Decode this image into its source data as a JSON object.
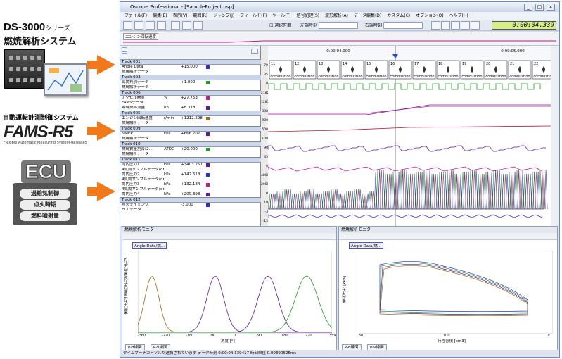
{
  "left": {
    "ds_title": "DS-3000",
    "ds_title_suffix": "シリーズ",
    "ds_subtitle": "燃焼解析システム",
    "fams_caption": "自動運転計測制御システム",
    "fams_logo": "FAMS-R5",
    "fams_sub": "Flexible Automatic Measuring System-Release5",
    "ecu_title": "ECU",
    "ecu_items": [
      "過給気制御",
      "点火時期",
      "燃料噴射量"
    ]
  },
  "window": {
    "title": "Oscope Professional - [SampleProject.osp]",
    "menu": [
      "ファイル(F)",
      "編集(E)",
      "表示(V)",
      "範囲(R)",
      "ジャンプ(J)",
      "フィールド(F)",
      "ツール(T)",
      "信号処理(S)",
      "波形解析(A)",
      "データ編集(D)",
      "カスタム(C)",
      "オプション(O)",
      "ヘルプ(H)"
    ],
    "toolbar": {
      "sync_label": "選択区間",
      "left_label": "左端時刻",
      "right_label": "右端時刻",
      "time_value": "0:00:04.339"
    },
    "overview_label": "エンジン回転速度",
    "timeline": {
      "t1": "0:00:04.000",
      "t2": "0:00:05.000"
    },
    "event_numbers": [
      "11",
      "12",
      "13",
      "14",
      "15",
      "16",
      "17",
      "18",
      "19",
      "20",
      "21",
      "22"
    ],
    "event_label": "combustion",
    "tracks": [
      {
        "header": "Track 001",
        "rows": [
          {
            "name": "Angle Data",
            "unit": "",
            "value": "+15.000"
          },
          {
            "name": "燃焼解析データ",
            "unit": "",
            "value": ""
          }
        ]
      },
      {
        "header": "Track 003",
        "rows": [
          {
            "name": "気筒判別データ",
            "unit": "",
            "value": "+1.000"
          },
          {
            "name": "燃焼解析データ",
            "unit": "",
            "value": ""
          }
        ]
      },
      {
        "header": "Track 006",
        "rows": [
          {
            "name": "アクセル開度",
            "unit": "%",
            "value": "+27.753"
          },
          {
            "name": "FAMSデータ",
            "unit": "",
            "value": ""
          },
          {
            "name": "瞬時燃料流量",
            "unit": "l/h",
            "value": "+8.378"
          }
        ]
      },
      {
        "header": "Track 005",
        "rows": [
          {
            "name": "エンジン回転速度",
            "unit": "r/min",
            "value": "+1212.298"
          },
          {
            "name": "燃焼解析データ",
            "unit": "",
            "value": ""
          }
        ]
      },
      {
        "header": "Track 009",
        "rows": [
          {
            "name": "NMEP",
            "unit": "kPa",
            "value": "+666.707"
          },
          {
            "name": "燃焼解析データ",
            "unit": "",
            "value": ""
          }
        ]
      },
      {
        "header": "Track 010",
        "rows": [
          {
            "name": "燃焼質量割合(2...",
            "unit": "ATDC",
            "value": "+20.000"
          },
          {
            "name": "燃焼解析データ",
            "unit": "",
            "value": ""
          }
        ]
      },
      {
        "header": "Track 011",
        "rows": [
          {
            "name": "筒内圧力1",
            "unit": "kPa",
            "value": "+3403.257"
          },
          {
            "name": "4気筒サンプルデータ(dma)(燃焼解析モニタ)",
            "unit": "",
            "value": ""
          },
          {
            "name": "筒内圧力2",
            "unit": "kPa",
            "value": "+142.618"
          },
          {
            "name": "4気筒サンプルデータ(dma)(燃焼解析モニタ)",
            "unit": "",
            "value": ""
          },
          {
            "name": "筒内圧力3",
            "unit": "kPa",
            "value": "+132.184"
          },
          {
            "name": "4気筒サンプルデータ(dma)(燃焼解析モニタ)",
            "unit": "",
            "value": ""
          },
          {
            "name": "筒内圧力4",
            "unit": "kPa",
            "value": "+209.398"
          }
        ]
      },
      {
        "header": "Track 012",
        "rows": [
          {
            "name": "点火タイミング",
            "unit": "",
            "value": "-3.000"
          },
          {
            "name": "ECUデータ",
            "unit": "",
            "value": ""
          }
        ]
      }
    ],
    "scale_labels": [
      "70",
      "35",
      "0",
      "2182",
      "1285",
      "308",
      "900",
      "500",
      "100",
      "90",
      "45",
      "0",
      "4000",
      "2000",
      "0",
      "10",
      "-3",
      "-15"
    ],
    "monitor_left": {
      "title": "燃焼解析モニタ",
      "tag": "Angle Data/燃...",
      "ylabel": "筒内圧力1/筒内圧力2/筒内圧力3",
      "xlabel": "角度 [°]",
      "xticks": [
        "-360",
        "-270",
        "-180",
        "-90",
        "0",
        "90",
        "180",
        "270",
        "359"
      ],
      "tabs": [
        "P-θ線図",
        "P-V線図"
      ]
    },
    "monitor_right": {
      "title": "燃焼解析モニタ",
      "tag": "Angle Data/燃...",
      "ylabel": "筒内圧力 [kPa]",
      "xlabel": "行程容積 [cm3]",
      "xticks": [
        "50",
        "100",
        "1k"
      ],
      "tabs": [
        "P-θ線図",
        "P-V線図"
      ]
    },
    "status": "ダイムサーチカーソルが選択されています  データ時刻 0:00:04.339417  時刻単位 0.00390625ms"
  },
  "colors": {
    "orange": "#f07a1a",
    "trackhead": "#c9d7ee",
    "magenta": "#c0168f",
    "green": "#1c9a1c",
    "purple": "#5a1c9a",
    "blue": "#2c2cd0",
    "brown": "#9a6a1c"
  }
}
